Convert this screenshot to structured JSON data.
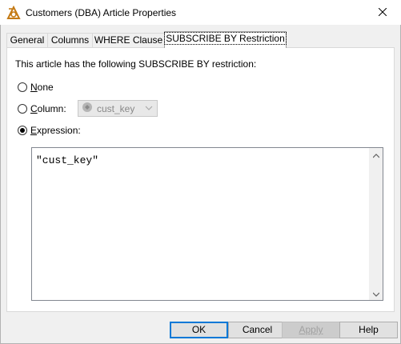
{
  "window": {
    "title": "Customers (DBA) Article Properties",
    "icon": "sybase-article-icon",
    "close_icon": "close-icon"
  },
  "tabs": [
    {
      "label": "General",
      "active": false
    },
    {
      "label": "Columns",
      "active": false
    },
    {
      "label": "WHERE Clause",
      "active": false
    },
    {
      "label": "SUBSCRIBE BY Restriction",
      "active": true
    }
  ],
  "panel": {
    "description": "This article has the following SUBSCRIBE BY restriction:",
    "options": {
      "none": {
        "prefix": "",
        "accel": "N",
        "rest": "one",
        "checked": false
      },
      "column": {
        "prefix": "",
        "accel": "C",
        "rest": "olumn:",
        "checked": false
      },
      "expression": {
        "prefix": "",
        "accel": "E",
        "rest": "xpression:",
        "checked": true
      }
    },
    "column_select": {
      "value": "cust_key",
      "enabled": false,
      "icon": "column-icon"
    },
    "expression_text": "\"cust_key\""
  },
  "buttons": {
    "ok": "OK",
    "cancel": "Cancel",
    "apply": "Apply",
    "help": "Help"
  },
  "colors": {
    "default_button_border": "#0078d7",
    "dialog_bg": "#f0f0f0"
  }
}
